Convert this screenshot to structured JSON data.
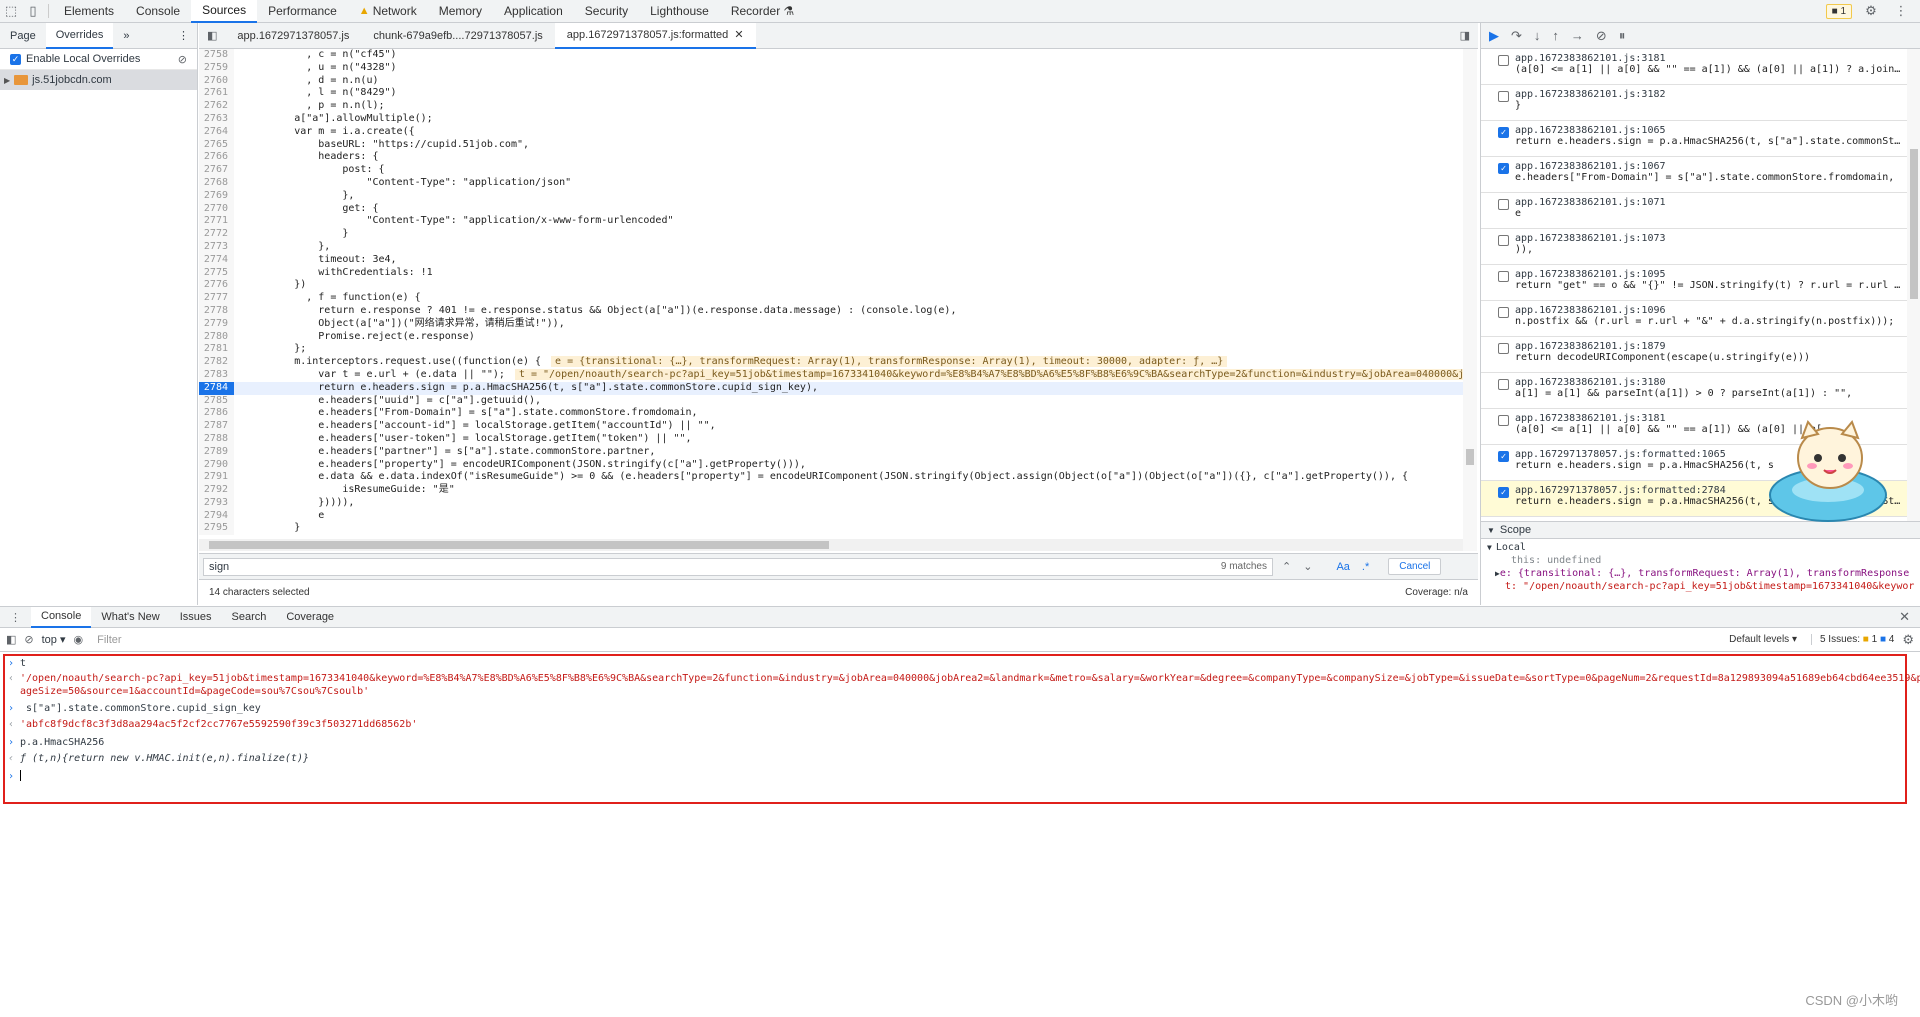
{
  "topbar": {
    "panels": [
      "Elements",
      "Console",
      "Sources",
      "Performance",
      "Network",
      "Memory",
      "Application",
      "Security",
      "Lighthouse",
      "Recorder"
    ],
    "active_panel": "Sources",
    "issues_badge": "1"
  },
  "sidebar": {
    "tabs": [
      "Page",
      "Overrides"
    ],
    "enable_label": "Enable Local Overrides",
    "folder": "js.51jobcdn.com"
  },
  "editor": {
    "tabs": [
      "app.1672971378057.js",
      "chunk-679a9efb....72971378057.js",
      "app.1672971378057.js:formatted"
    ],
    "lines": [
      {
        "n": "2758",
        "code": "            , c = n(\"cf45\")"
      },
      {
        "n": "2759",
        "code": "            , u = n(\"4328\")"
      },
      {
        "n": "2760",
        "code": "            , d = n.n(u)"
      },
      {
        "n": "2761",
        "code": "            , l = n(\"8429\")"
      },
      {
        "n": "2762",
        "code": "            , p = n.n(l);"
      },
      {
        "n": "2763",
        "code": "          a[\"a\"].allowMultiple();"
      },
      {
        "n": "2764",
        "code": "          var m = i.a.create({"
      },
      {
        "n": "2765",
        "code": "              baseURL: \"https://cupid.51job.com\","
      },
      {
        "n": "2766",
        "code": "              headers: {"
      },
      {
        "n": "2767",
        "code": "                  post: {"
      },
      {
        "n": "2768",
        "code": "                      \"Content-Type\": \"application/json\""
      },
      {
        "n": "2769",
        "code": "                  },"
      },
      {
        "n": "2770",
        "code": "                  get: {"
      },
      {
        "n": "2771",
        "code": "                      \"Content-Type\": \"application/x-www-form-urlencoded\""
      },
      {
        "n": "2772",
        "code": "                  }"
      },
      {
        "n": "2773",
        "code": "              },"
      },
      {
        "n": "2774",
        "code": "              timeout: 3e4,"
      },
      {
        "n": "2775",
        "code": "              withCredentials: !1"
      },
      {
        "n": "2776",
        "code": "          })"
      },
      {
        "n": "2777",
        "code": "            , f = function(e) {"
      },
      {
        "n": "2778",
        "code": "              return e.response ? 401 != e.response.status && Object(a[\"a\"])(e.response.data.message) : (console.log(e),"
      },
      {
        "n": "2779",
        "code": "              Object(a[\"a\"])(\"网络请求异常，请稍后重试!\")),"
      },
      {
        "n": "2780",
        "code": "              Promise.reject(e.response)"
      },
      {
        "n": "2781",
        "code": "          };"
      },
      {
        "n": "2782",
        "code": "          m.interceptors.request.use((function(e) {",
        "inline": "e = {transitional: {…}, transformRequest: Array(1), transformResponse: Array(1), timeout: 30000, adapter: ƒ, …}"
      },
      {
        "n": "2783",
        "code": "              var t = e.url + (e.data || \"\");",
        "inline": "t = \"/open/noauth/search-pc?api_key=51job&timestamp=1673341040&keyword=%E8%B4%A7%E8%BD%A6%E5%8F%B8%E6%9C%BA&searchType=2&function=&industry=&jobArea=040000&jobAr"
      },
      {
        "n": "2784",
        "code": "              return e.headers.sign = p.a.HmacSHA256(t, s[\"a\"].state.commonStore.cupid_sign_key),",
        "cur": true
      },
      {
        "n": "2785",
        "code": "              e.headers[\"uuid\"] = c[\"a\"].getuuid(),"
      },
      {
        "n": "2786",
        "code": "              e.headers[\"From-Domain\"] = s[\"a\"].state.commonStore.fromdomain,"
      },
      {
        "n": "2787",
        "code": "              e.headers[\"account-id\"] = localStorage.getItem(\"accountId\") || \"\","
      },
      {
        "n": "2788",
        "code": "              e.headers[\"user-token\"] = localStorage.getItem(\"token\") || \"\","
      },
      {
        "n": "2789",
        "code": "              e.headers[\"partner\"] = s[\"a\"].state.commonStore.partner,"
      },
      {
        "n": "2790",
        "code": "              e.headers[\"property\"] = encodeURIComponent(JSON.stringify(c[\"a\"].getProperty())),"
      },
      {
        "n": "2791",
        "code": "              e.data && e.data.indexOf(\"isResumeGuide\") >= 0 && (e.headers[\"property\"] = encodeURIComponent(JSON.stringify(Object.assign(Object(o[\"a\"])(Object(o[\"a\"])({}, c[\"a\"].getProperty()), {"
      },
      {
        "n": "2792",
        "code": "                  isResumeGuide: \"是\""
      },
      {
        "n": "2793",
        "code": "              })))),"
      },
      {
        "n": "2794",
        "code": "              e"
      },
      {
        "n": "2795",
        "code": "          }"
      }
    ],
    "search_value": "sign",
    "matches": "9 matches",
    "case_label": "Aa",
    "regex_label": ".*",
    "cancel": "Cancel",
    "status_left": "14 characters selected",
    "status_right": "Coverage: n/a"
  },
  "debugger": {
    "breakpoints": [
      {
        "file": "app.1672383862101.js:3181",
        "code": "(a[0] <= a[1] || a[0] && \"\" == a[1]) && (a[0] || a[1]) ? a.join…",
        "checked": false
      },
      {
        "file": "app.1672383862101.js:3182",
        "code": "}",
        "checked": false
      },
      {
        "file": "app.1672383862101.js:1065",
        "code": "return e.headers.sign = p.a.HmacSHA256(t, s[\"a\"].state.commonSt…",
        "checked": true
      },
      {
        "file": "app.1672383862101.js:1067",
        "code": "e.headers[\"From-Domain\"] = s[\"a\"].state.commonStore.fromdomain,",
        "checked": true
      },
      {
        "file": "app.1672383862101.js:1071",
        "code": "e",
        "checked": false
      },
      {
        "file": "app.1672383862101.js:1073",
        "code": ")),",
        "checked": false
      },
      {
        "file": "app.1672383862101.js:1095",
        "code": "return \"get\" == o && \"{}\" != JSON.stringify(t) ? r.url = r.url …",
        "checked": false
      },
      {
        "file": "app.1672383862101.js:1096",
        "code": "n.postfix && (r.url = r.url + \"&\" + d.a.stringify(n.postfix)));",
        "checked": false
      },
      {
        "file": "app.1672383862101.js:1879",
        "code": "return decodeURIComponent(escape(u.stringify(e)))",
        "checked": false
      },
      {
        "file": "app.1672383862101.js:3180",
        "code": "a[1] = a[1] && parseInt(a[1]) > 0 ? parseInt(a[1]) : \"\",",
        "checked": false
      },
      {
        "file": "app.1672383862101.js:3181",
        "code": "(a[0] <= a[1] || a[0] && \"\" == a[1]) && (a[0] || a[",
        "checked": false
      },
      {
        "file": "app.1672971378057.js:formatted:1065",
        "code": "return e.headers.sign = p.a.HmacSHA256(t, s",
        "checked": true
      },
      {
        "file": "app.1672971378057.js:formatted:2784",
        "code": "return e.headers.sign = p.a.HmacSHA256(t, s[\"a\"].state.commonSt…",
        "checked": true,
        "hl": true
      }
    ],
    "scope_title": "Scope",
    "local_title": "Local",
    "scope_this": "this: undefined",
    "scope_e": "e: {transitional: {…}, transformRequest: Array(1), transformResponse",
    "scope_t": "t: \"/open/noauth/search-pc?api_key=51job&timestamp=1673341040&keywor"
  },
  "drawer": {
    "tabs": [
      "Console",
      "What's New",
      "Issues",
      "Search",
      "Coverage"
    ],
    "context": "top",
    "filter_placeholder": "Filter",
    "levels": "Default levels ▾",
    "issues": "5 Issues:",
    "issues_warn": "1",
    "issues_info": "4"
  },
  "console": {
    "in1": "t",
    "out1a": "'/open/noauth/search-pc?api_key=51job&timestamp=1673341040&keyword=%E8%B4%A7%E8%BD%A6%E5%8F%B8%E6%9C%BA&searchType=2&function=&industry=&jobArea=040000&jobArea2=&landmark=&metro=&salary=&workYear=&degree=&companyType=&companySize=&jobType=&issueDate=&sortType=0&pageNum=2&requestId=8a129893094a51689eb64cbd64ee3519&p",
    "out1b": "ageSize=50&source=1&accountId=&pageCode=sou%7Csou%7Csoulb'",
    "in2": " s[\"a\"].state.commonStore.cupid_sign_key",
    "out2": "'abfc8f9dcf8c3f3d8aa294ac5f2cf2cc7767e5592590f39c3f503271dd68562b'",
    "in3": "p.a.HmacSHA256",
    "out3": "ƒ (t,n){return new v.HMAC.init(e,n).finalize(t)}"
  },
  "watermark": "CSDN @小木哟"
}
